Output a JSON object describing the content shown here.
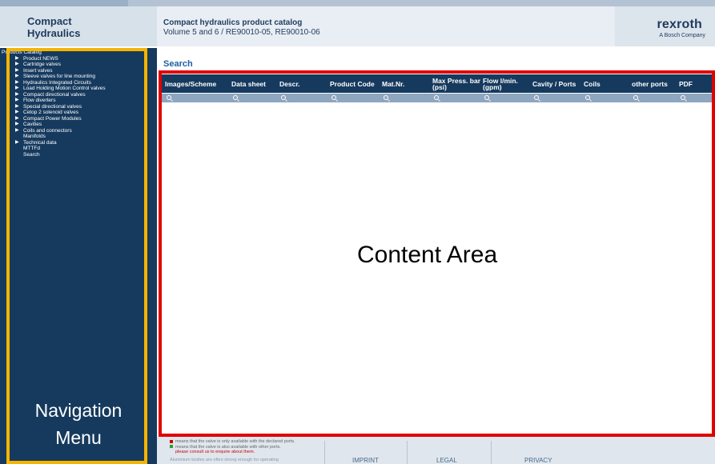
{
  "app": {
    "brand_line1": "Compact",
    "brand_line2": "Hydraulics",
    "catalog_title": "Compact hydraulics product catalog",
    "catalog_subtitle": "Volume 5 and 6  / RE90010-05, RE90010-06",
    "logo_name": "rexroth",
    "logo_sub": "A Bosch Company"
  },
  "nav": {
    "root": "Products Catalog",
    "items": [
      {
        "label": "Product NEWS",
        "arrow": true
      },
      {
        "label": "Cartridge valves",
        "arrow": true
      },
      {
        "label": "Insert valves",
        "arrow": true
      },
      {
        "label": "Sleeve valves for line mounting",
        "arrow": true
      },
      {
        "label": "Hydraulics Integrated Circuits",
        "arrow": true
      },
      {
        "label": "Load Holding Motion Control valves",
        "arrow": true
      },
      {
        "label": "Compact directional valves",
        "arrow": true
      },
      {
        "label": "Flow diverters",
        "arrow": true
      },
      {
        "label": "Special directional valves",
        "arrow": true
      },
      {
        "label": "Cetop 2 solenoid valves",
        "arrow": true
      },
      {
        "label": "Compact Power Modules",
        "arrow": true
      },
      {
        "label": "Cavities",
        "arrow": true
      },
      {
        "label": "Coils and connectors",
        "arrow": true
      },
      {
        "label": "Manifolds",
        "arrow": false
      },
      {
        "label": "Technical data",
        "arrow": true
      },
      {
        "label": "MTTFd",
        "arrow": false
      },
      {
        "label": "Search",
        "arrow": false
      }
    ],
    "annotation_line1": "Navigation",
    "annotation_line2": "Menu"
  },
  "main": {
    "title": "Search",
    "columns": [
      "Images/Scheme",
      "Data sheet",
      "Descr.",
      "Product Code",
      "Mat.Nr.",
      "Max Press. bar (psi)",
      "Flow l/min. (gpm)",
      "Cavity / Ports",
      "Coils",
      "other ports",
      "PDF"
    ],
    "annotation": "Content Area"
  },
  "footer": {
    "legend": [
      {
        "text": "means that the valve is only available with the declared ports.",
        "color": "#cc0000"
      },
      {
        "text": "means that the valve is also available with other ports.",
        "color": "#2e9e2e"
      },
      {
        "text": "please consult us to enquire about them.",
        "color": "#cc0000"
      }
    ],
    "legend_cut": "Aluminium bodies are often strong enough for operating",
    "links": [
      "IMPRINT",
      "LEGAL",
      "PRIVACY"
    ]
  },
  "colors": {
    "nav_bg": "#163a5e",
    "nav_outline": "#f5b400",
    "content_outline": "#e00000",
    "accent_title": "#1f5fa0"
  }
}
